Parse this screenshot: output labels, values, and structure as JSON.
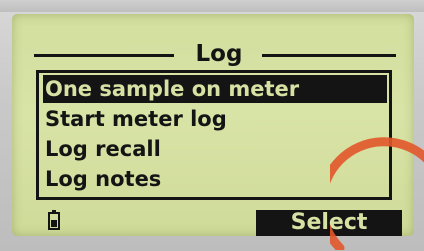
{
  "screen": {
    "title": "Log",
    "menu": {
      "items": [
        {
          "label": "One sample on meter",
          "selected": true
        },
        {
          "label": "Start meter log",
          "selected": false
        },
        {
          "label": "Log recall",
          "selected": false
        },
        {
          "label": "Log notes",
          "selected": false
        }
      ]
    },
    "status": {
      "battery_icon": "battery-icon",
      "softkey_label": "Select"
    }
  },
  "colors": {
    "lcd_background": "#d6e1a3",
    "lcd_ink": "#141414",
    "bezel": "#c9c9c9",
    "watermark": "#e2572b"
  }
}
